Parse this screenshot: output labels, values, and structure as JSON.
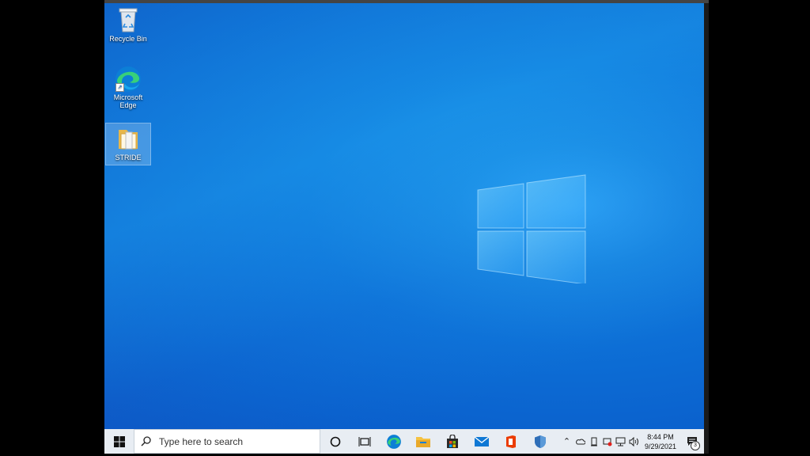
{
  "desktop": {
    "icons": [
      {
        "label": "Recycle Bin"
      },
      {
        "label": "Microsoft Edge"
      },
      {
        "label": "STRIDE"
      }
    ]
  },
  "taskbar": {
    "search_placeholder": "Type here to search",
    "apps": [
      "task-view",
      "edge",
      "file-explorer",
      "microsoft-store",
      "mail",
      "office",
      "security"
    ],
    "clock_time": "8:44 PM",
    "clock_date": "9/29/2021",
    "notification_count": "3"
  },
  "colors": {
    "accent": "#0a6fd6",
    "taskbar": "#e8edf3"
  }
}
